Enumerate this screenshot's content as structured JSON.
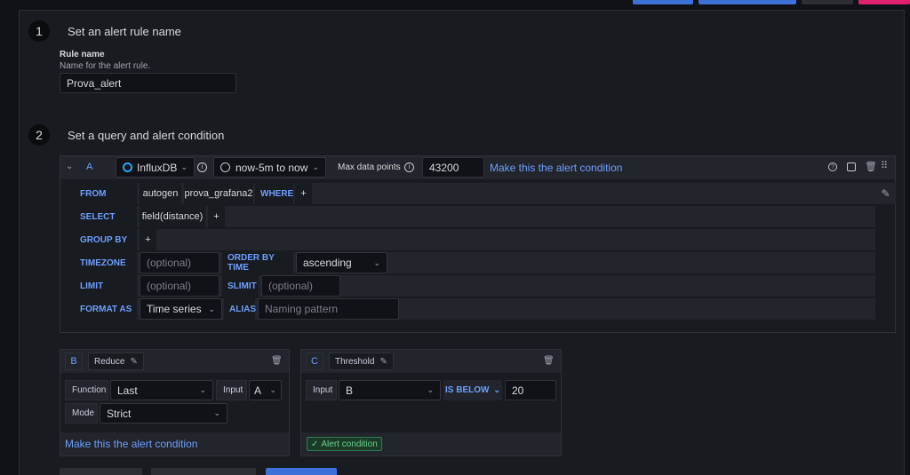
{
  "step1": {
    "number": "1",
    "title": "Set an alert rule name"
  },
  "rule": {
    "label": "Rule name",
    "description": "Name for the alert rule.",
    "value": "Prova_alert"
  },
  "step2": {
    "number": "2",
    "title": "Set a query and alert condition"
  },
  "queryA": {
    "refId": "A",
    "datasource": "InfluxDB",
    "timeRange": "now-5m to now",
    "maxDataPointsLabel": "Max data points",
    "maxDataPointsValue": "43200",
    "conditionLink": "Make this the alert condition",
    "rows": {
      "from": {
        "keyword": "FROM",
        "policy": "autogen",
        "measurement": "prova_grafana2",
        "where": "WHERE",
        "add": "+"
      },
      "select": {
        "keyword": "SELECT",
        "field": "field(distance)",
        "add": "+"
      },
      "groupBy": {
        "keyword": "GROUP BY",
        "add": "+"
      },
      "timezone": {
        "keyword": "TIMEZONE",
        "placeholder": "(optional)",
        "orderLabel": "ORDER BY TIME",
        "orderValue": "ascending"
      },
      "limit": {
        "keyword": "LIMIT",
        "placeholder": "(optional)",
        "slimitLabel": "SLIMIT",
        "slimitPlaceholder": "(optional)"
      },
      "format": {
        "keyword": "FORMAT AS",
        "value": "Time series",
        "aliasLabel": "ALIAS",
        "aliasPlaceholder": "Naming pattern"
      }
    }
  },
  "exprB": {
    "refId": "B",
    "type": "Reduce",
    "functionLabel": "Function",
    "functionValue": "Last",
    "inputLabel": "Input",
    "inputValue": "A",
    "modeLabel": "Mode",
    "modeValue": "Strict",
    "conditionLink": "Make this the alert condition"
  },
  "exprC": {
    "refId": "C",
    "type": "Threshold",
    "inputLabel": "Input",
    "inputValue": "B",
    "operator": "IS BELOW",
    "thresholdValue": "20",
    "badge": "Alert condition"
  },
  "colors": {
    "accent": "#6e9fff",
    "primaryBtn": "#3d71d9",
    "dangerBtn": "#e0226e",
    "success": "#6ccf8e"
  }
}
